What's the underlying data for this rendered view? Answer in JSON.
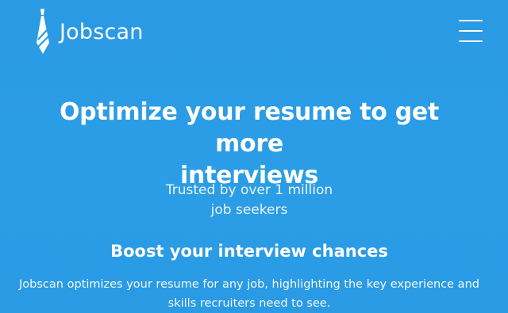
{
  "header": {
    "logo_text": "Jobscan",
    "logo_icon": "tie-icon",
    "menu_icon": "hamburger-menu-icon"
  },
  "hero": {
    "title_line1": "Optimize your resume to get more",
    "title_line2": "interviews",
    "trusted_line1": "Trusted by over 1 million",
    "trusted_line2": "job seekers"
  },
  "section": {
    "heading": "Boost your interview chances",
    "body": "Jobscan optimizes your resume for any job, highlighting the key experience and skills recruiters need to see."
  },
  "colors": {
    "background": "#2b9ce5",
    "text": "#ffffff"
  }
}
